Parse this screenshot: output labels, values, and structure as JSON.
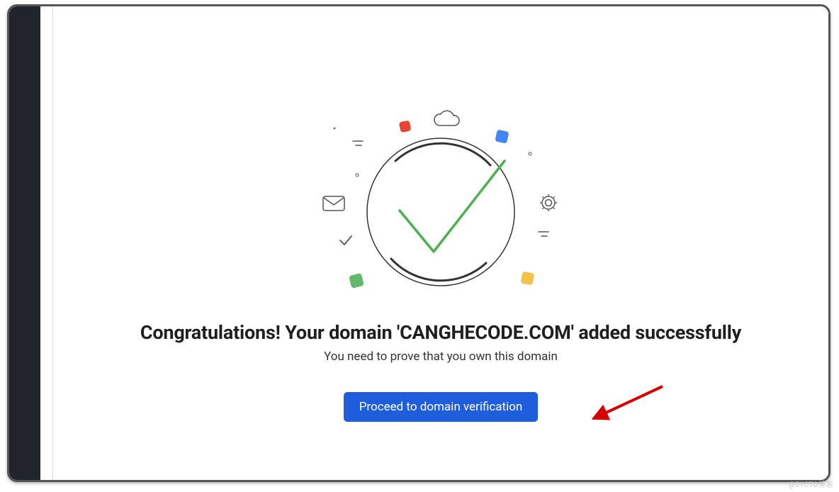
{
  "domain_name": "CANGHECODE.COM",
  "heading_prefix": "Congratulations! Your domain '",
  "heading_suffix": "' added successfully",
  "subtext": "You need to prove that you own this domain",
  "button_label": "Proceed to domain verification",
  "watermark": "@51CTO博客",
  "colors": {
    "button_bg": "#1e5ddb",
    "sidebar_bg": "#1f252b",
    "check_green": "#4caf50",
    "square_red": "#e94335",
    "square_blue": "#4285f4",
    "square_green": "#62b96a",
    "square_yellow": "#f4c24b"
  },
  "icons": {
    "cloud": "cloud-icon",
    "gear": "gear-icon",
    "mail": "mail-icon",
    "small_check": "small-check-icon",
    "big_check": "big-check-icon"
  }
}
